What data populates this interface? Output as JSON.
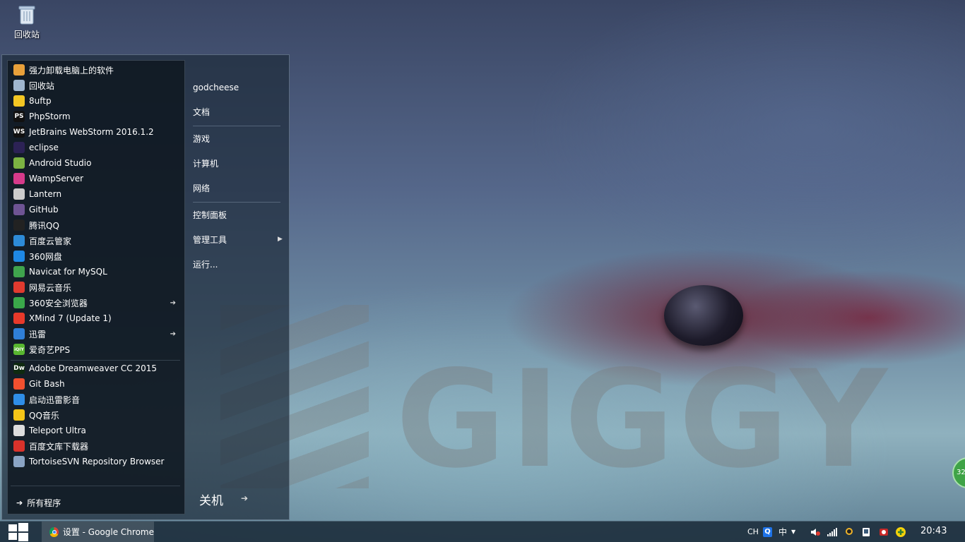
{
  "desktop": {
    "icons": [
      {
        "label": "回收站",
        "icon": "recycle-bin-icon"
      }
    ],
    "widget_badge": "32"
  },
  "start_menu": {
    "pinned_programs": [
      {
        "label": "强力卸载电脑上的软件",
        "icon": "uninstall-icon",
        "color": "#e8a03a"
      },
      {
        "label": "回收站",
        "icon": "recycle-bin-icon",
        "color": "#9fb6cf"
      },
      {
        "label": "8uftp",
        "icon": "8uftp-icon",
        "color": "#f3c623"
      },
      {
        "label": "PhpStorm",
        "icon": "phpstorm-icon",
        "color": "#111111",
        "glyph": "PS"
      },
      {
        "label": "JetBrains WebStorm 2016.1.2",
        "icon": "webstorm-icon",
        "color": "#111111",
        "glyph": "WS"
      },
      {
        "label": "eclipse",
        "icon": "eclipse-icon",
        "color": "#2c2255"
      },
      {
        "label": "Android Studio",
        "icon": "android-studio-icon",
        "color": "#7cb342"
      },
      {
        "label": "WampServer",
        "icon": "wampserver-icon",
        "color": "#d63a8a"
      },
      {
        "label": "Lantern",
        "icon": "lantern-icon",
        "color": "#cccccc"
      },
      {
        "label": "GitHub",
        "icon": "github-icon",
        "color": "#6e5494"
      },
      {
        "label": "腾讯QQ",
        "icon": "qq-icon",
        "color": "#222222"
      },
      {
        "label": "百度云管家",
        "icon": "baidu-cloud-icon",
        "color": "#2d8bd8"
      },
      {
        "label": "360网盘",
        "icon": "360-cloud-icon",
        "color": "#1e88e5"
      },
      {
        "label": "Navicat for MySQL",
        "icon": "navicat-icon",
        "color": "#3fa34d"
      },
      {
        "label": "网易云音乐",
        "icon": "netease-music-icon",
        "color": "#e03a2f"
      },
      {
        "label": "360安全浏览器",
        "icon": "360-browser-icon",
        "color": "#3aa84a",
        "submenu": true
      },
      {
        "label": "XMind 7 (Update 1)",
        "icon": "xmind-icon",
        "color": "#e8392a"
      },
      {
        "label": "迅雷",
        "icon": "xunlei-icon",
        "color": "#2f7fd8",
        "submenu": true
      },
      {
        "label": "爱奇艺PPS",
        "icon": "iqiyi-icon",
        "color": "#58b630",
        "glyph": "iQIY"
      }
    ],
    "recent_programs": [
      {
        "label": "Adobe Dreamweaver CC 2015",
        "icon": "dreamweaver-icon",
        "color": "#0f2a10",
        "glyph": "Dw"
      },
      {
        "label": "Git Bash",
        "icon": "git-bash-icon",
        "color": "#f1502f"
      },
      {
        "label": "启动迅雷影音",
        "icon": "xunlei-player-icon",
        "color": "#2f8ee8"
      },
      {
        "label": "QQ音乐",
        "icon": "qq-music-icon",
        "color": "#f5c518"
      },
      {
        "label": "Teleport Ultra",
        "icon": "teleport-icon",
        "color": "#dddddd"
      },
      {
        "label": "百度文库下载器",
        "icon": "baidu-wenku-icon",
        "color": "#d9322b"
      },
      {
        "label": "TortoiseSVN Repository Browser",
        "icon": "tortoisesvn-icon",
        "color": "#8aa4c4"
      }
    ],
    "all_programs_label": "所有程序",
    "right_items": [
      {
        "label": "godcheese",
        "group": 1
      },
      {
        "label": "文档",
        "group": 1
      },
      {
        "label": "游戏",
        "group": 2
      },
      {
        "label": "计算机",
        "group": 2
      },
      {
        "label": "网络",
        "group": 2
      },
      {
        "label": "控制面板",
        "group": 3
      },
      {
        "label": "管理工具",
        "group": 3,
        "submenu": true
      },
      {
        "label": "运行...",
        "group": 3
      }
    ],
    "shutdown_label": "关机"
  },
  "taskbar": {
    "active_window": "设置 - Google Chrome",
    "tray": {
      "language": "CH",
      "ime_mode": "中",
      "time": "20:43"
    }
  }
}
